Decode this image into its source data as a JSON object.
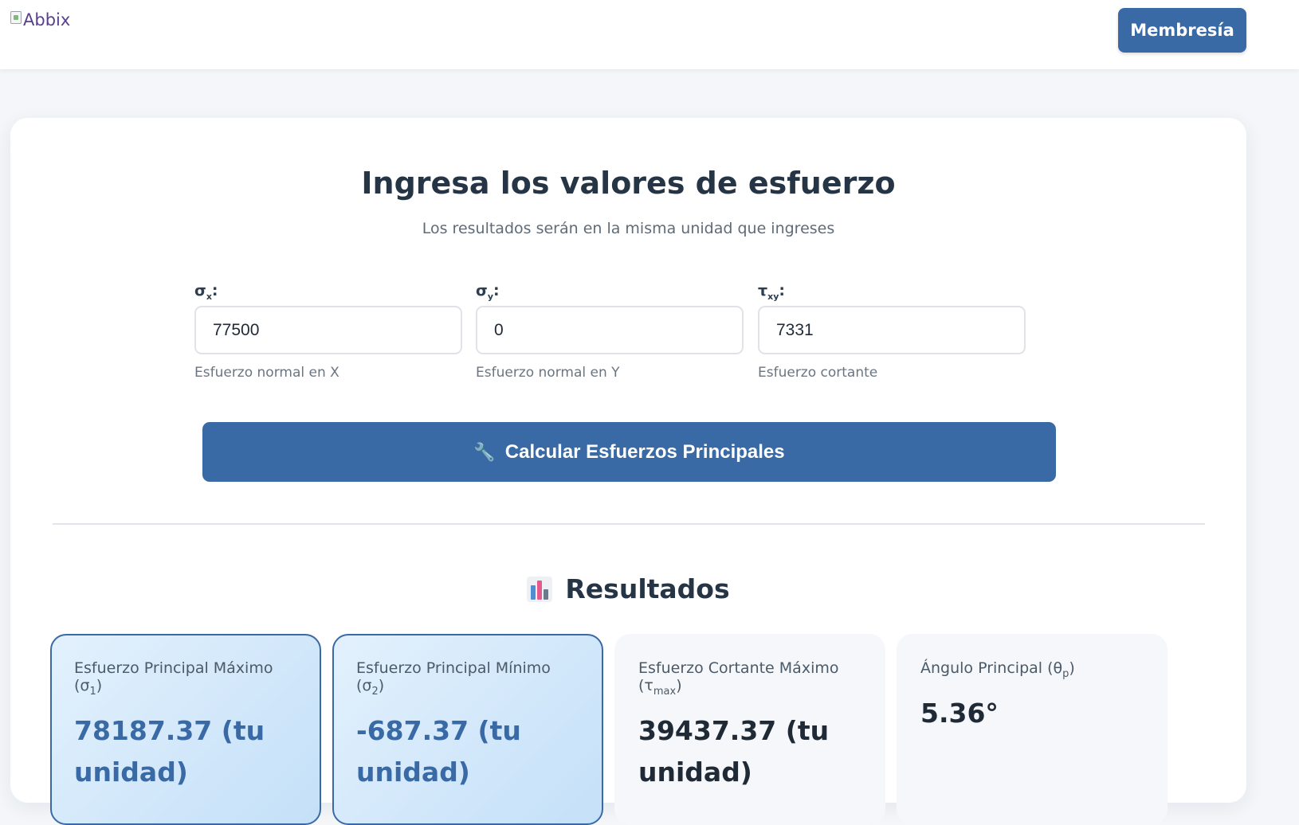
{
  "header": {
    "logo_alt": "Abbix",
    "membership_label": "Membresía"
  },
  "form": {
    "title": "Ingresa los valores de esfuerzo",
    "subtitle": "Los resultados serán en la misma unidad que ingreses",
    "fields": [
      {
        "symbol": "σ",
        "sub": "x",
        "suffix": ":",
        "value": "77500",
        "help": "Esfuerzo normal en X"
      },
      {
        "symbol": "σ",
        "sub": "y",
        "suffix": ":",
        "value": "0",
        "help": "Esfuerzo normal en Y"
      },
      {
        "symbol": "τ",
        "sub": "xy",
        "suffix": ":",
        "value": "7331",
        "help": "Esfuerzo cortante"
      }
    ],
    "calculate_label": "Calcular Esfuerzos Principales",
    "calculate_icon": "wrench-icon"
  },
  "results": {
    "title": "Resultados",
    "title_icon": "bar-chart-icon",
    "cards": [
      {
        "label": "Esfuerzo Principal Máximo (σ",
        "label_sub": "1",
        "label_end": ")",
        "value": "78187.37 (tu unidad)",
        "highlighted": true
      },
      {
        "label": "Esfuerzo Principal Mínimo (σ",
        "label_sub": "2",
        "label_end": ")",
        "value": "-687.37 (tu unidad)",
        "highlighted": true
      },
      {
        "label": "Esfuerzo Cortante Máximo (τ",
        "label_sub": "max",
        "label_end": ")",
        "value": "39437.37 (tu unidad)",
        "highlighted": false
      },
      {
        "label": "Ángulo Principal (θ",
        "label_sub": "p",
        "label_end": ")",
        "value": "5.36°",
        "highlighted": false
      }
    ]
  },
  "colors": {
    "primary": "#3a6aa5",
    "card_highlight": "#c4e0f8",
    "text_dark": "#253545"
  }
}
